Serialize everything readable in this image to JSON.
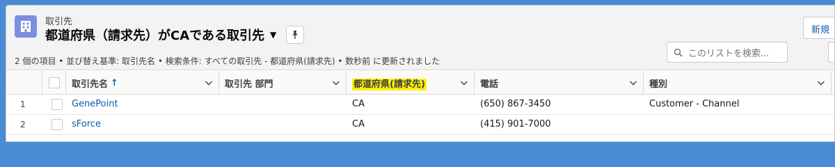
{
  "header": {
    "object_label": "取引先",
    "list_title": "都道府県（請求先）がCAである取引先",
    "new_button": "新規",
    "info_text": "2 個の項目 • 並び替え基準: 取引先名 • 検索条件: すべての取引先 - 都道府県(請求先) • 数秒前 に更新されました",
    "search_placeholder": "このリストを検索..."
  },
  "table": {
    "columns": [
      {
        "label": "取引先名",
        "sorted": "asc"
      },
      {
        "label": "取引先 部門"
      },
      {
        "label": "都道府県(請求先)",
        "highlighted": true
      },
      {
        "label": "電話"
      },
      {
        "label": "種別"
      }
    ],
    "rows": [
      {
        "num": "1",
        "name": "GenePoint",
        "division": "",
        "state": "CA",
        "phone": "(650) 867-3450",
        "type": "Customer - Channel"
      },
      {
        "num": "2",
        "name": "sForce",
        "division": "",
        "state": "CA",
        "phone": "(415) 901-7000",
        "type": ""
      }
    ]
  },
  "colors": {
    "background": "#4a8bd6",
    "object_icon": "#7f8de1",
    "link": "#0b5cab",
    "highlight": "#fff200"
  },
  "icons": [
    "account-object-icon",
    "chevron-down-icon",
    "pin-icon",
    "search-icon",
    "sort-ascending-icon"
  ]
}
